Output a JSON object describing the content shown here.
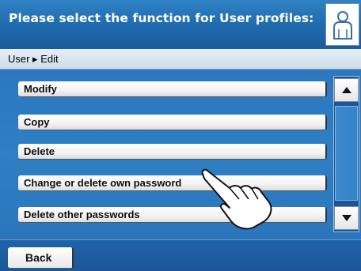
{
  "header": {
    "title": "Please select the function for User profiles:",
    "user_icon": "user-profile-icon"
  },
  "breadcrumb": {
    "text": "User ▸ Edit"
  },
  "menu": {
    "items": [
      {
        "label": "Modify"
      },
      {
        "label": "Copy"
      },
      {
        "label": "Delete"
      },
      {
        "label": "Change or delete own password"
      },
      {
        "label": "Delete other passwords"
      }
    ]
  },
  "scrollbar": {
    "up_icon": "arrow-up-icon",
    "down_icon": "arrow-down-icon"
  },
  "footer": {
    "back_label": "Back"
  },
  "overlay": {
    "hand_icon": "pointing-hand-icon"
  },
  "colors": {
    "header_blue": "#1f69ad",
    "list_blue": "#2e7fc5",
    "footer_blue": "#1b5797",
    "breadcrumb_bg": "#dce6f0"
  }
}
